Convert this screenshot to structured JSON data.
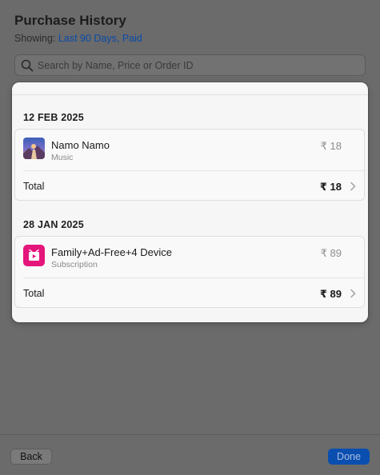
{
  "header": {
    "title": "Purchase History",
    "showing_label": "Showing:",
    "showing_filter": "Last 90 Days, Paid"
  },
  "search": {
    "placeholder": "Search by Name, Price or Order ID",
    "value": ""
  },
  "purchases": [
    {
      "date": "12 FEB 2025",
      "item_name": "Namo Namo",
      "item_type": "Music",
      "item_price": "₹ 18",
      "total_label": "Total",
      "total_value": "₹ 18",
      "icon": "album-art-icon"
    },
    {
      "date": "28 JAN 2025",
      "item_name": "Family+Ad-Free+4 Device",
      "item_type": "Subscription",
      "item_price": "₹ 89",
      "total_label": "Total",
      "total_value": "₹ 89",
      "icon": "subscription-app-icon"
    }
  ],
  "footer": {
    "back_label": "Back",
    "done_label": "Done"
  },
  "colors": {
    "accent": "#0a4fb0",
    "subscription_icon": "#e5167b"
  }
}
